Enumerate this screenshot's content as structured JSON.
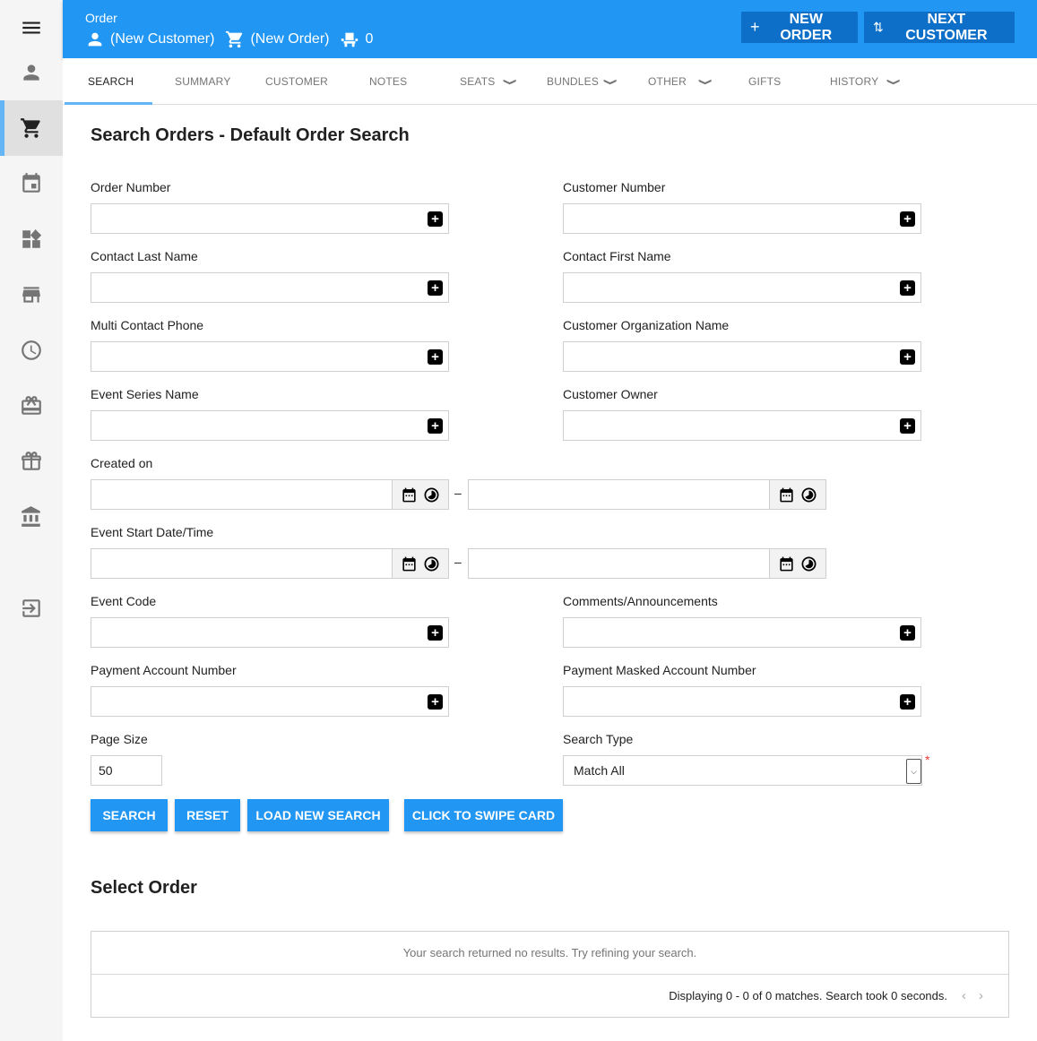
{
  "header": {
    "title": "Order",
    "customer": "(New Customer)",
    "order": "(New Order)",
    "seat_count": "0",
    "new_order_label": "NEW ORDER",
    "next_customer_label": "NEXT CUSTOMER",
    "color": "#2196f3",
    "button_color": "#0d6fc7"
  },
  "sidebar": {
    "items": [
      {
        "icon": "menu-icon"
      },
      {
        "icon": "person-icon"
      },
      {
        "icon": "cart-icon",
        "active": true
      },
      {
        "icon": "calendar-icon"
      },
      {
        "icon": "widgets-icon"
      },
      {
        "icon": "store-icon"
      },
      {
        "icon": "clock-icon"
      },
      {
        "icon": "card-giftcard-icon"
      },
      {
        "icon": "gift-icon"
      },
      {
        "icon": "bank-icon"
      },
      {
        "icon": "exit-icon"
      }
    ]
  },
  "tabs": [
    {
      "label": "SEARCH",
      "active": true
    },
    {
      "label": "SUMMARY"
    },
    {
      "label": "CUSTOMER"
    },
    {
      "label": "NOTES"
    },
    {
      "label": "SEATS",
      "dropdown": true
    },
    {
      "label": "BUNDLES",
      "dropdown": true
    },
    {
      "label": "OTHER",
      "dropdown": true
    },
    {
      "label": "GIFTS"
    },
    {
      "label": "HISTORY",
      "dropdown": true
    }
  ],
  "form": {
    "title": "Search Orders - Default Order Search",
    "fields": {
      "order_number": {
        "label": "Order Number",
        "value": ""
      },
      "customer_number": {
        "label": "Customer Number",
        "value": ""
      },
      "contact_last_name": {
        "label": "Contact Last Name",
        "value": ""
      },
      "contact_first_name": {
        "label": "Contact First Name",
        "value": ""
      },
      "multi_contact_phone": {
        "label": "Multi Contact Phone",
        "value": ""
      },
      "customer_org_name": {
        "label": "Customer Organization Name",
        "value": ""
      },
      "event_series_name": {
        "label": "Event Series Name",
        "value": ""
      },
      "customer_owner": {
        "label": "Customer Owner",
        "value": ""
      },
      "created_on": {
        "label": "Created on",
        "from": "",
        "to": ""
      },
      "event_start": {
        "label": "Event Start Date/Time",
        "from": "",
        "to": ""
      },
      "event_code": {
        "label": "Event Code",
        "value": ""
      },
      "comments": {
        "label": "Comments/Announcements",
        "value": ""
      },
      "payment_account": {
        "label": "Payment Account Number",
        "value": ""
      },
      "payment_masked": {
        "label": "Payment Masked Account Number",
        "value": ""
      },
      "page_size": {
        "label": "Page Size",
        "value": "50"
      },
      "search_type": {
        "label": "Search Type",
        "value": "Match All",
        "required_marker": "*"
      }
    },
    "range_separator": "–",
    "buttons": {
      "search": "SEARCH",
      "reset": "RESET",
      "load_new_search": "LOAD NEW SEARCH",
      "swipe_card": "CLICK TO SWIPE CARD"
    }
  },
  "results": {
    "title": "Select Order",
    "empty_message": "Your search returned no results. Try refining your search.",
    "status": "Displaying 0 - 0 of 0 matches. Search took 0 seconds."
  }
}
